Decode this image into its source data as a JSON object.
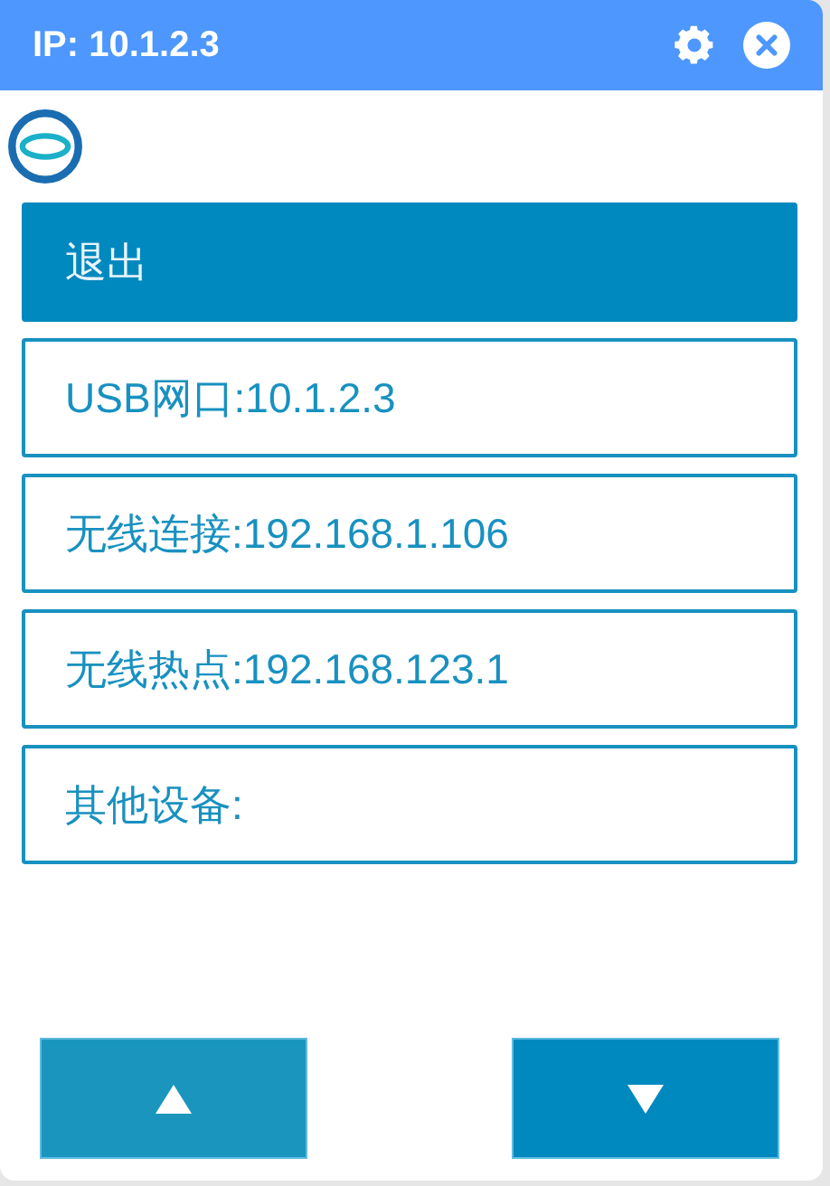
{
  "window": {
    "title": "IP: 10.1.2.3"
  },
  "items": [
    {
      "label": "退出",
      "selected": true
    },
    {
      "label": "USB网口:10.1.2.3",
      "selected": false
    },
    {
      "label": "无线连接:192.168.1.106",
      "selected": false
    },
    {
      "label": "无线热点:192.168.123.1",
      "selected": false
    },
    {
      "label": "其他设备:",
      "selected": false
    }
  ],
  "buttons": [
    {
      "kind": "up",
      "disabled": true
    },
    {
      "kind": "down",
      "disabled": false
    }
  ]
}
